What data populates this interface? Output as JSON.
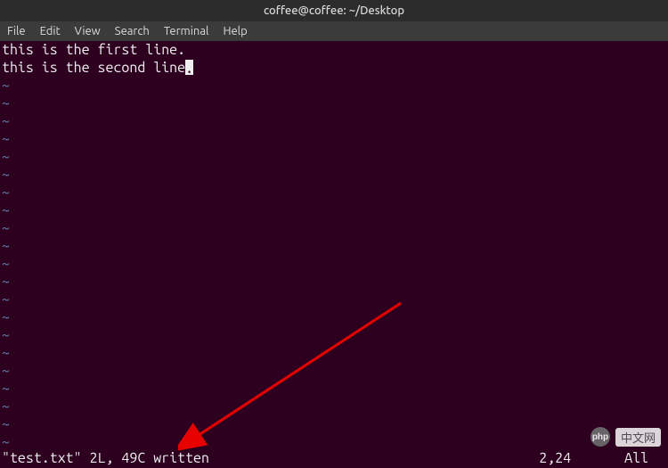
{
  "window": {
    "title": "coffee@coffee: ~/Desktop"
  },
  "menubar": {
    "items": [
      {
        "label": "File"
      },
      {
        "label": "Edit"
      },
      {
        "label": "View"
      },
      {
        "label": "Search"
      },
      {
        "label": "Terminal"
      },
      {
        "label": "Help"
      }
    ]
  },
  "editor": {
    "lines": [
      "this is the first line.",
      "this is the second line"
    ],
    "cursor_after": ".",
    "tilde_count": 21,
    "tilde_char": "~"
  },
  "statusbar": {
    "left": "\"test.txt\" 2L, 49C written",
    "position": "2,24",
    "scroll": "All"
  },
  "watermark": {
    "logo_text": "php",
    "text": "中文网"
  }
}
